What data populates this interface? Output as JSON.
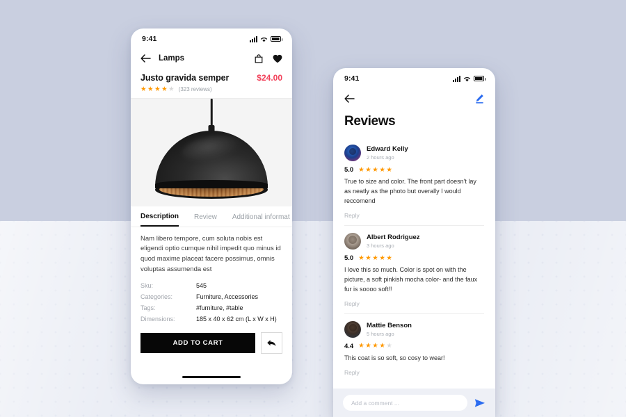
{
  "background": {
    "top_color": "#c9cfe0",
    "bottom_color": "#e9ecf4",
    "dot_color": "#dfe3ee"
  },
  "product_screen": {
    "status_bar": {
      "time": "9:41",
      "icons": [
        "signal-icon",
        "wifi-icon",
        "battery-icon"
      ]
    },
    "nav": {
      "back_icon": "arrow-left-icon",
      "title": "Lamps",
      "bag_icon": "shopping-bag-icon",
      "favorite_icon": "heart-filled-icon"
    },
    "product": {
      "title": "Justo gravida semper",
      "price": "$24.00",
      "rating": 4,
      "rating_max": 5,
      "reviews_count": "(323 reviews)",
      "image_alt": "black-pendant-dome-lamp-with-copper-interior"
    },
    "tabs": [
      {
        "label": "Description",
        "active": true
      },
      {
        "label": "Review",
        "active": false
      },
      {
        "label": "Additional informat",
        "active": false
      }
    ],
    "description": "Nam libero tempore, cum soluta nobis est eligendi optio cumque nihil impedit quo minus id quod maxime placeat facere possimus, omnis voluptas assumenda est",
    "specs": [
      {
        "label": "Sku:",
        "value": "545"
      },
      {
        "label": "Categories:",
        "value": "Furniture, Accessories"
      },
      {
        "label": "Tags:",
        "value": "#furniture, #table"
      },
      {
        "label": "Dimensions:",
        "value": "185 x 40 x 62 cm (L x W x H)"
      }
    ],
    "actions": {
      "add_to_cart_label": "ADD TO CART",
      "share_icon": "reply-arrow-icon"
    },
    "accent_price_color": "#f2415a"
  },
  "reviews_screen": {
    "status_bar": {
      "time": "9:41",
      "icons": [
        "signal-icon",
        "wifi-icon",
        "battery-icon"
      ]
    },
    "nav": {
      "back_icon": "arrow-left-icon",
      "edit_icon": "pencil-edit-icon",
      "edit_icon_color": "#2b6cf0"
    },
    "page_title": "Reviews",
    "reviews": [
      {
        "name": "Edward Kelly",
        "time": "2 hours ago",
        "score": "5.0",
        "stars": 5,
        "text": "True to size and color. The front part doesn't lay as neatly as the photo but overally I would reccomend",
        "reply_label": "Reply",
        "avatar": "avatar-edward-kelly"
      },
      {
        "name": "Albert Rodriguez",
        "time": "3 hours ago",
        "score": "5.0",
        "stars": 5,
        "text": "I love this so much. Color is spot on with the picture, a soft pinkish mocha color- and the faux fur is soooo soft!!",
        "reply_label": "Reply",
        "avatar": "avatar-albert-rodriguez"
      },
      {
        "name": "Mattie Benson",
        "time": "5 hours ago",
        "score": "4.4",
        "stars": 4,
        "text": "This coat is so soft, so cosy to wear!",
        "reply_label": "Reply",
        "avatar": "avatar-mattie-benson"
      }
    ],
    "comment_bar": {
      "placeholder": "Add a comment ...",
      "send_icon": "send-paper-plane-icon",
      "send_icon_color": "#2b6cf0"
    }
  },
  "star_colors": {
    "on": "#ff9800",
    "off": "#d9d9d9"
  }
}
